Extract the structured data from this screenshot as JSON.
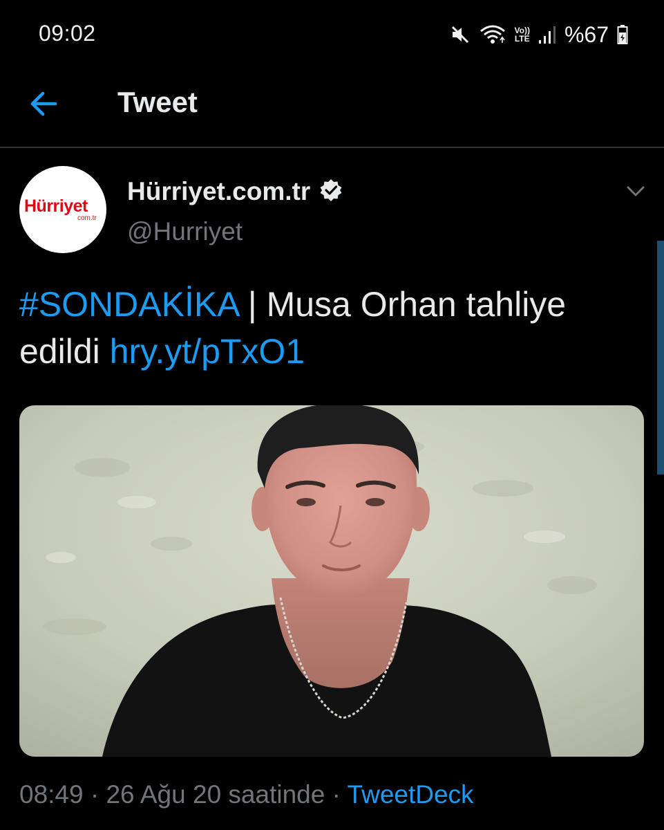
{
  "status_bar": {
    "time": "09:02",
    "icons": [
      "mute-icon",
      "wifi-icon",
      "volte-lte-icon",
      "signal-icon",
      "battery-icon"
    ],
    "lte_top": "Vo))",
    "lte_bottom": "LTE",
    "battery": "%67"
  },
  "header": {
    "back_icon": "back-arrow-icon",
    "title": "Tweet"
  },
  "tweet": {
    "avatar": {
      "logo_text": "Hürriyet",
      "logo_subtext": "com.tr"
    },
    "display_name": "Hürriyet.com.tr",
    "verified_icon": "verified-badge-icon",
    "handle": "@Hurriyet",
    "menu_icon": "chevron-down-icon",
    "text": {
      "hashtag": "#SONDAKİKA",
      "body": " | Musa Orhan tahliye edildi ",
      "link": "hry.yt/pTxO1"
    },
    "media": {
      "description_icon": "photo"
    },
    "meta": {
      "time": "08:49",
      "separator": " · ",
      "date": "26 Ağu 20 saatinde",
      "separator2": " · ",
      "source": "TweetDeck"
    }
  },
  "colors": {
    "background": "#000000",
    "accent": "#1d9bf0",
    "text_primary": "#e7e9ea",
    "text_secondary": "#71767b",
    "divider": "#2f3336",
    "brand_red": "#e30613"
  }
}
